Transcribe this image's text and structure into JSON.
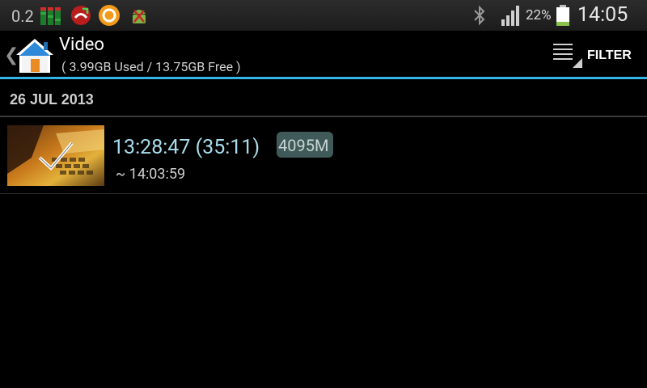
{
  "statusbar": {
    "left_value": "0.2",
    "notification_icons": [
      "equalizer-icon",
      "phone-missed-icon",
      "shield-o-icon",
      "android-debug-icon"
    ],
    "battery_percent": "22%",
    "time": "14:05",
    "icons": [
      "bluetooth-icon",
      "signal-icon",
      "battery-icon"
    ]
  },
  "actionbar": {
    "title": "Video",
    "subtitle": "( 3.99GB Used / 13.75GB Free )",
    "filter_label": "FILTER",
    "accent_color": "#33b5e5"
  },
  "sections": [
    {
      "header": "26 JUL 2013",
      "items": [
        {
          "start_time": "13:28:47 (35:11)",
          "size": "4095M",
          "end_time": "~ 14:03:59",
          "checked": true
        }
      ]
    }
  ]
}
